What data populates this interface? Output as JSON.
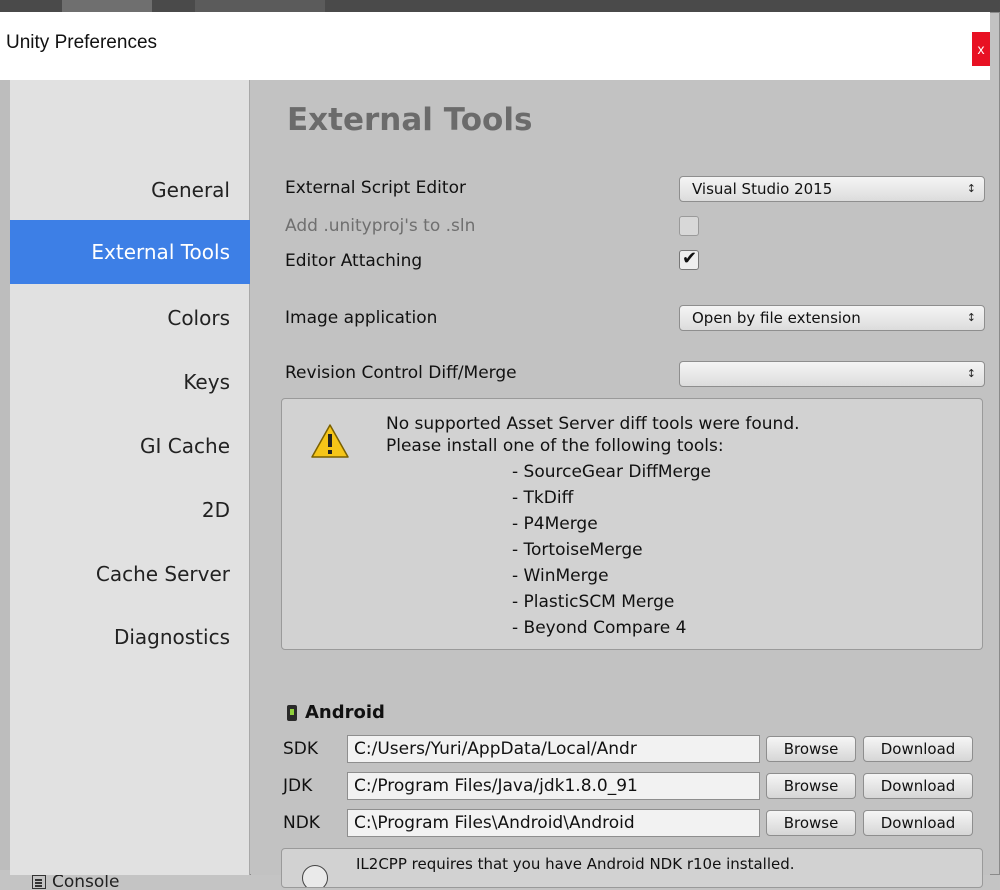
{
  "window": {
    "title": "Unity Preferences",
    "close_label": "x"
  },
  "background": {
    "console_tab_label": "Console"
  },
  "sidebar": {
    "items": [
      {
        "label": "General"
      },
      {
        "label": "External Tools",
        "active": true
      },
      {
        "label": "Colors"
      },
      {
        "label": "Keys"
      },
      {
        "label": "GI Cache"
      },
      {
        "label": "2D"
      },
      {
        "label": "Cache Server"
      },
      {
        "label": "Diagnostics"
      }
    ]
  },
  "main": {
    "heading": "External Tools",
    "script_editor": {
      "label": "External Script Editor",
      "value": "Visual Studio 2015"
    },
    "add_unityproj": {
      "label": "Add .unityproj's to .sln",
      "checked": false,
      "enabled": false
    },
    "editor_attaching": {
      "label": "Editor Attaching",
      "checked": true
    },
    "image_application": {
      "label": "Image application",
      "value": "Open by file extension"
    },
    "revision_control": {
      "label": "Revision Control Diff/Merge",
      "value": ""
    },
    "warning": {
      "line1": "No supported Asset Server diff tools were found.",
      "line2": "Please install one of the following tools:",
      "tools": [
        "- SourceGear DiffMerge",
        "- TkDiff",
        "- P4Merge",
        "- TortoiseMerge",
        "- WinMerge",
        "- PlasticSCM Merge",
        "- Beyond Compare 4"
      ]
    },
    "android": {
      "heading": "Android",
      "browse_label": "Browse",
      "download_label": "Download",
      "rows": [
        {
          "label": "SDK",
          "path": "C:/Users/Yuri/AppData/Local/Andr"
        },
        {
          "label": "JDK",
          "path": "C:/Program Files/Java/jdk1.8.0_91"
        },
        {
          "label": "NDK",
          "path": "C:\\Program Files\\Android\\Android"
        }
      ],
      "il2cpp_note": "IL2CPP requires that you have Android NDK r10e installed."
    }
  },
  "colors": {
    "active_sidebar": "#3d7fe6",
    "close_button": "#e81123",
    "warning_icon": "#f5c518"
  }
}
